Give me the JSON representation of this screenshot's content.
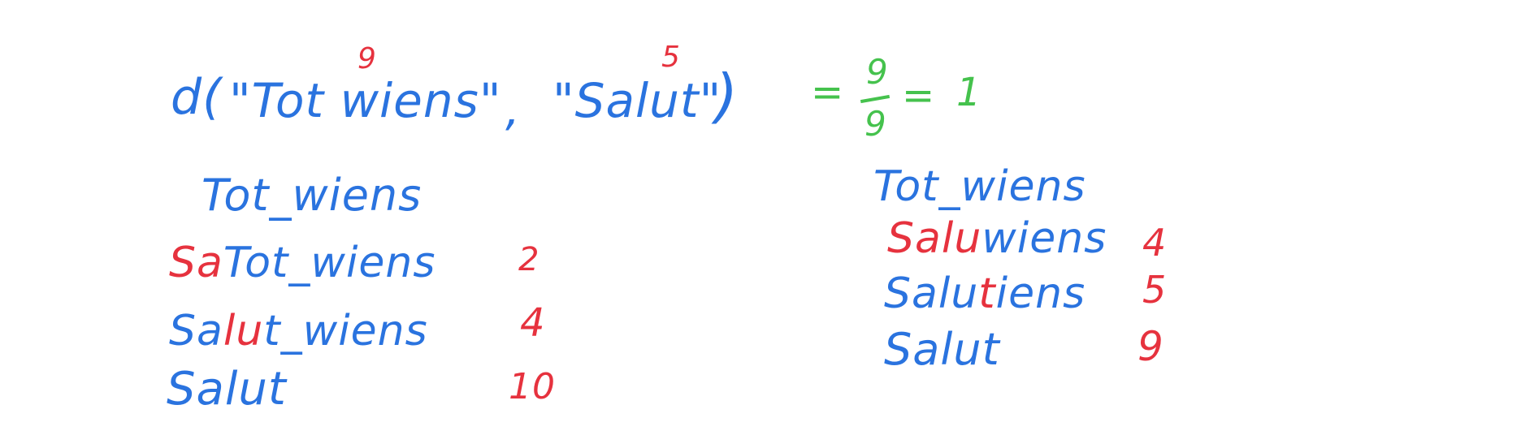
{
  "colors": {
    "blue": "#2a73df",
    "red": "#e6323e",
    "green": "#45c24d",
    "background": "#ffffff"
  },
  "formula": {
    "prefix": "d(",
    "arg1": "\"Tot wiens\"",
    "comma": ",",
    "arg2": "\"Salut\"",
    "close": ")",
    "note_arg1": "9",
    "note_arg2": "5",
    "equals1": "=",
    "frac_num": "9",
    "frac_den": "9",
    "equals2": "=",
    "result": "1"
  },
  "left_steps": {
    "start": {
      "plain": "Tot_wiens"
    },
    "rows": [
      {
        "red": "Sa",
        "blue": "Tot_wiens",
        "value": "2"
      },
      {
        "blue1": "Sa",
        "red": "lu",
        "blue2": "t_wiens",
        "value": "4"
      },
      {
        "blue": "Salut",
        "value": "10"
      }
    ]
  },
  "right_steps": {
    "start": {
      "plain": "Tot_wiens"
    },
    "rows": [
      {
        "red": "Salu",
        "blue": "wiens",
        "value": "4"
      },
      {
        "blue1": "Salu",
        "red": "t",
        "blue2": "iens",
        "value": "5"
      },
      {
        "blue": "Salut",
        "value": "9"
      }
    ]
  }
}
